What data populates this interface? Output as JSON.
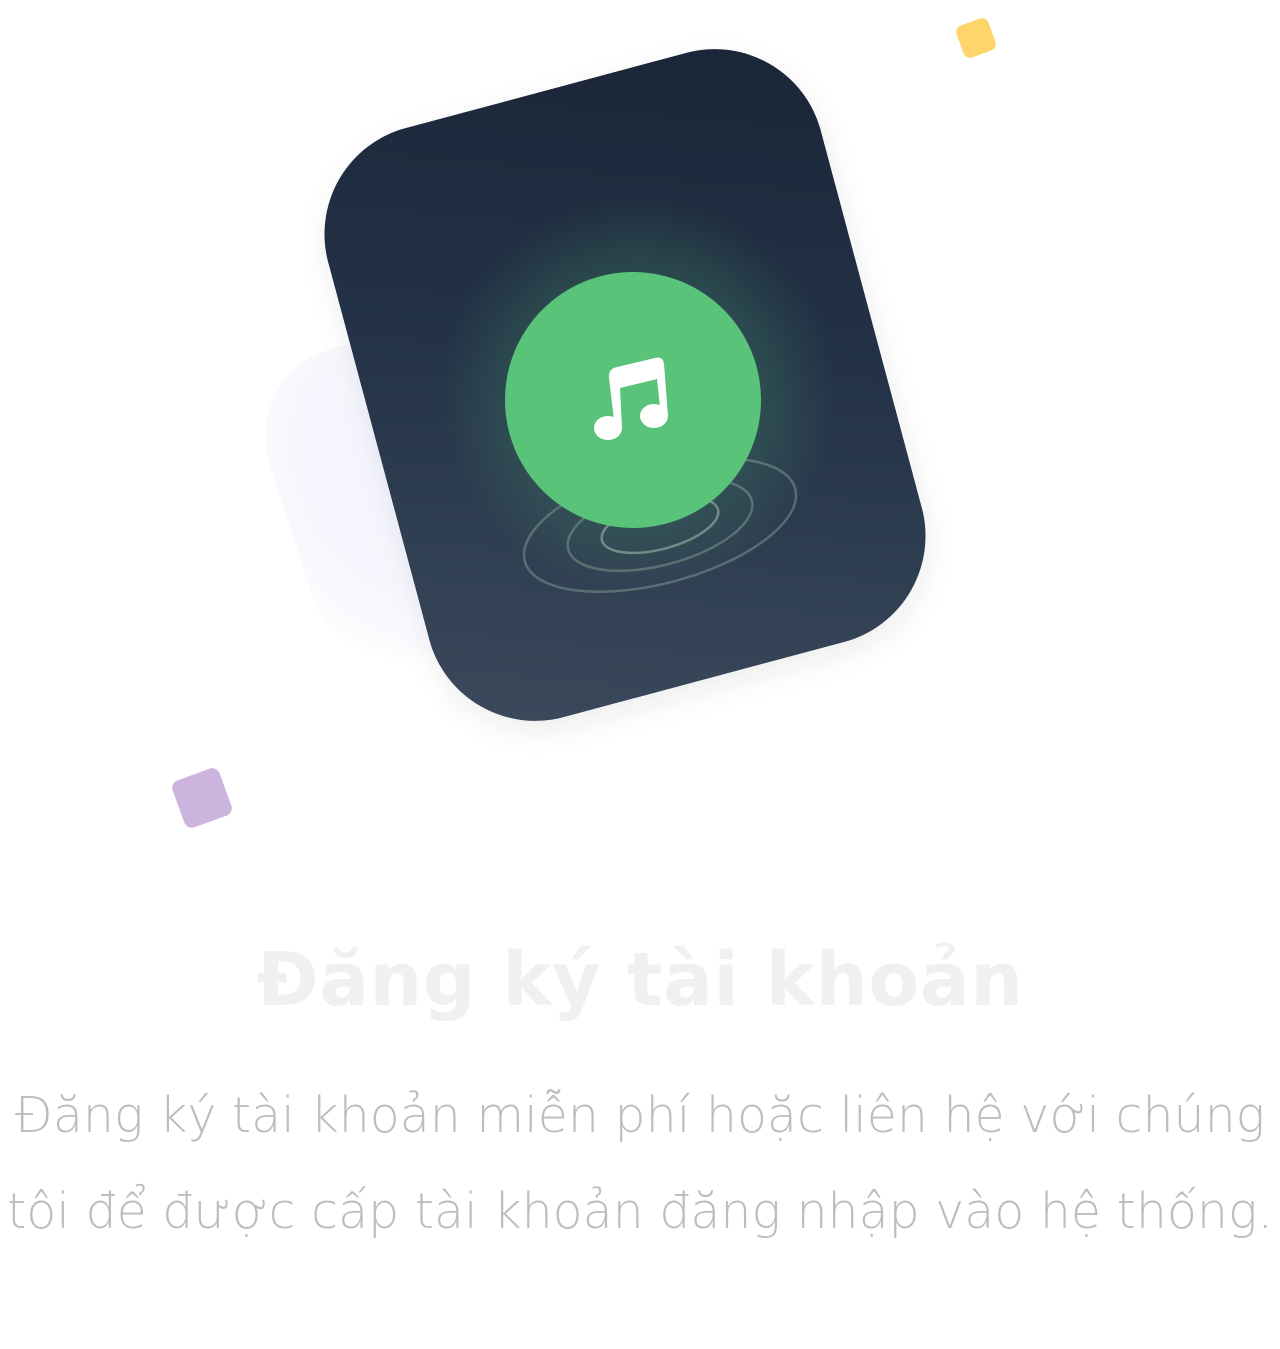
{
  "illustration": {
    "icon": "music-note-icon",
    "colors": {
      "card_dark": "#1a2536",
      "card_light": "#3b4b5c",
      "disc_green": "#5ac37a",
      "confetti_yellow": "#ffd56b",
      "confetti_purple": "#cdb4de"
    }
  },
  "content": {
    "title": "Đăng ký tài khoản",
    "description": "Đăng ký tài khoản miễn phí hoặc liên hệ với chúng tôi để được cấp tài khoản đăng nhập vào hệ thống."
  },
  "colors": {
    "title": "#f0f0f0",
    "description": "#bdbdbd"
  }
}
